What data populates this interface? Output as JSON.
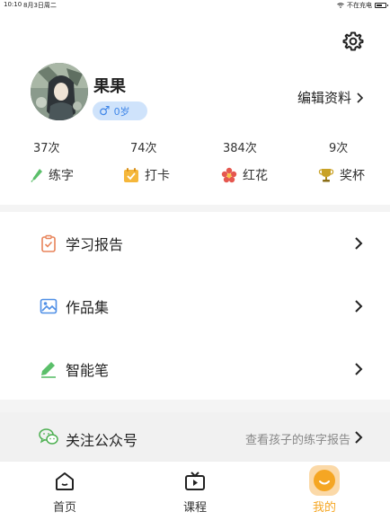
{
  "status_bar": {
    "time": "10:10",
    "date": "8月3日周二",
    "charging": "不在充电"
  },
  "profile": {
    "name": "果果",
    "gender_symbol": "♂",
    "age": "0岁",
    "edit_label": "编辑资料"
  },
  "stats": [
    {
      "count": "37次",
      "label": "练字",
      "icon": "brush-icon",
      "color": "#5bbf6a"
    },
    {
      "count": "74次",
      "label": "打卡",
      "icon": "calendar-check-icon",
      "color": "#f5b73b"
    },
    {
      "count": "384次",
      "label": "红花",
      "icon": "flower-icon",
      "color": "#e5574f"
    },
    {
      "count": "9次",
      "label": "奖杯",
      "icon": "trophy-icon",
      "color": "#c9a227"
    }
  ],
  "menu": [
    {
      "label": "学习报告",
      "icon": "clipboard-check-icon",
      "color": "#e8845a"
    },
    {
      "label": "作品集",
      "icon": "gallery-icon",
      "color": "#4f8fe6"
    },
    {
      "label": "智能笔",
      "icon": "smart-pen-icon",
      "color": "#5bbf6a"
    }
  ],
  "wechat": {
    "label": "关注公众号",
    "hint": "查看孩子的练字报告",
    "icon": "wechat-icon"
  },
  "tabs": [
    {
      "label": "首页",
      "icon": "home-icon",
      "active": false
    },
    {
      "label": "课程",
      "icon": "tv-icon",
      "active": false
    },
    {
      "label": "我的",
      "icon": "smile-face-icon",
      "active": true
    }
  ],
  "colors": {
    "accent": "#f5a623",
    "badge_bg": "#cfe3fb",
    "badge_text": "#3f86e8"
  }
}
